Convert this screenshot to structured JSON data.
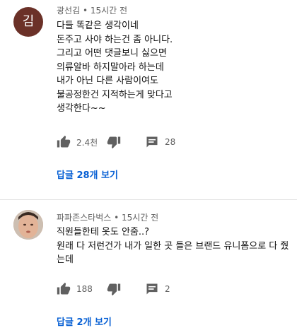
{
  "comments": [
    {
      "avatar_letter": "김",
      "author": "광선김",
      "time": "15시간 전",
      "lines": [
        "다들 똑같은 생각이네",
        "돈주고 사야 하는건 좀 아니다.",
        "그리고 어떤 댓글보니 싫으면",
        "의류알바 하지말아라 하는데",
        "내가 아닌 다른 사람이여도",
        "불공정한건 지적하는게 맞다고",
        "생각한다~~"
      ],
      "likes": "2.4천",
      "reply_count": "28",
      "view_replies": "답글 28개 보기"
    },
    {
      "author": "파파존스타벅스",
      "time": "15시간 전",
      "lines": [
        "직원들한테 옷도 안줌..?",
        "원래 다 저런건가 내가 일한 곳 들은 브랜드 유니폼으로 다 줬",
        "는데"
      ],
      "likes": "188",
      "reply_count": "2",
      "view_replies": "답글 2개 보기"
    }
  ],
  "separator": "•",
  "colors": {
    "link": "#065fd4",
    "meta": "#606060",
    "icon": "#606060",
    "avatar1": "#6b3128"
  },
  "icons": [
    "thumb-up-icon",
    "thumb-down-icon",
    "comment-icon"
  ]
}
